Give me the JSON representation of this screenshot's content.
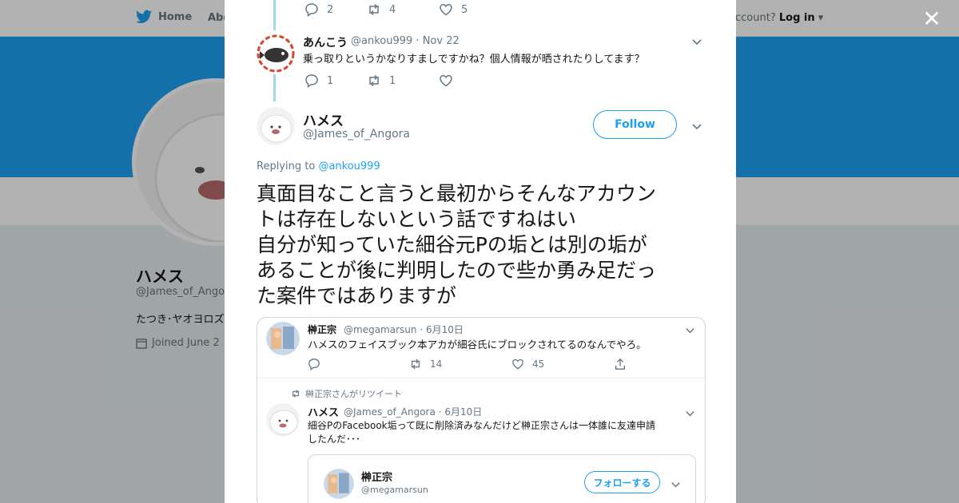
{
  "background": {
    "nav": {
      "home": "Home",
      "about": "Abo",
      "account_text": "ccount?",
      "login": "Log in"
    },
    "profile": {
      "name": "ハメス",
      "handle": "@James_of_Ango",
      "bio": "たつき･ヤオヨロズ",
      "joined": "Joined June 2"
    }
  },
  "modal": {
    "top_actions": {
      "replies": "2",
      "retweets": "4",
      "likes": "5"
    },
    "reply_tweet": {
      "name": "あんこう",
      "handle": "@ankou999",
      "date": "Nov 22",
      "text": "乗っ取りというかなりすましですかね？個人情報が晒されたりしてます？",
      "replies": "1",
      "retweets": "1"
    },
    "main_tweet": {
      "name": "ハメス",
      "handle": "@James_of_Angora",
      "follow_label": "Follow",
      "replying_prefix": "Replying to",
      "replying_to": "@ankou999",
      "lines": [
        "真面目なこと言うと最初からそんなアカウン",
        "トは存在しないという話ですねはい",
        "自分が知っていた細谷元Pの垢とは別の垢が",
        "あることが後に判明したので些か勇み足だっ",
        "た案件ではありますが"
      ]
    },
    "quote": {
      "tweet1": {
        "name": "榊正宗",
        "handle": "@megamarsun",
        "date": "6月10日",
        "text": "ハメスのフェイスブック本アカが細谷氏にブロックされてるのなんでやろ。",
        "retweets": "14",
        "likes": "45"
      },
      "retweet_label": "榊正宗さんがリツイート",
      "tweet2": {
        "name": "ハメス",
        "handle": "@James_of_Angora",
        "date": "6月10日",
        "text_line1": "細谷PのFacebook垢って既に削除済みなんだけど榊正宗さんは一体誰に友達申請",
        "text_line2": "したんだ･･･"
      },
      "embed": {
        "name": "榊正宗",
        "handle": "@megamarsun",
        "follow_label": "フォローする"
      }
    }
  },
  "colors": {
    "accent": "#1da1f2",
    "thread_line": "#a3d5f7",
    "muted": "#657786"
  }
}
